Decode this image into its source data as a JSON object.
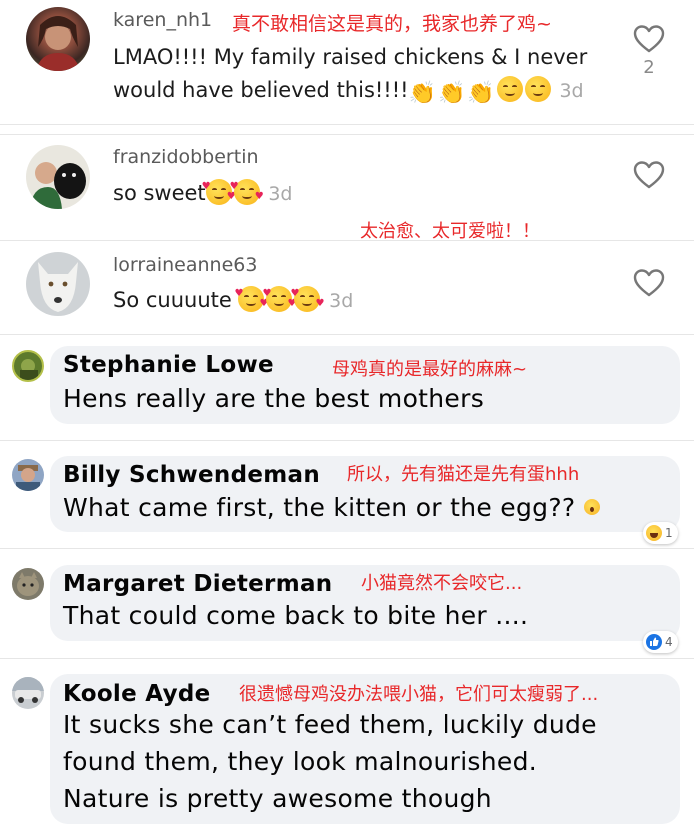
{
  "tiktok_comments": [
    {
      "username": "karen_nh1",
      "text_line1": "LMAO!!!! My family raised chickens & I never",
      "text_line2": "would have believed this!!!!",
      "time": "3d",
      "likes": "2",
      "translation": "真不敢相信这是真的，我家也养了鸡~"
    },
    {
      "username": "franzidobbertin",
      "text": "so sweet",
      "time": "3d",
      "translation": "太治愈、太可爱啦！！"
    },
    {
      "username": "lorraineanne63",
      "text": "So cuuuute ",
      "time": "3d"
    }
  ],
  "facebook_comments": [
    {
      "name": "Stephanie Lowe",
      "text": "Hens really are the best mothers",
      "translation": "母鸡真的是最好的麻麻~"
    },
    {
      "name": "Billy Schwendeman",
      "text": "What came first, the kitten or the egg??",
      "translation": "所以，先有猫还是先有蛋hhh",
      "reaction": "haha",
      "reaction_count": "1"
    },
    {
      "name": "Margaret Dieterman",
      "text": "That could come back to bite her ....",
      "translation": "小猫竟然不会咬它...",
      "reaction": "like",
      "reaction_count": "4"
    },
    {
      "name": "Koole Ayde",
      "text_line1": "It sucks she can’t feed them, luckily dude",
      "text_line2": "found them, they look malnourished.",
      "text_line3": "Nature is pretty awesome though",
      "translation": "很遗憾母鸡没办法喂小猫，它们可太瘦弱了..."
    }
  ],
  "colors": {
    "translation_red": "#e8282a",
    "bubble_bg": "#f0f2f5",
    "username_gray": "#5a5a5a",
    "time_gray": "#a8a8a8"
  }
}
